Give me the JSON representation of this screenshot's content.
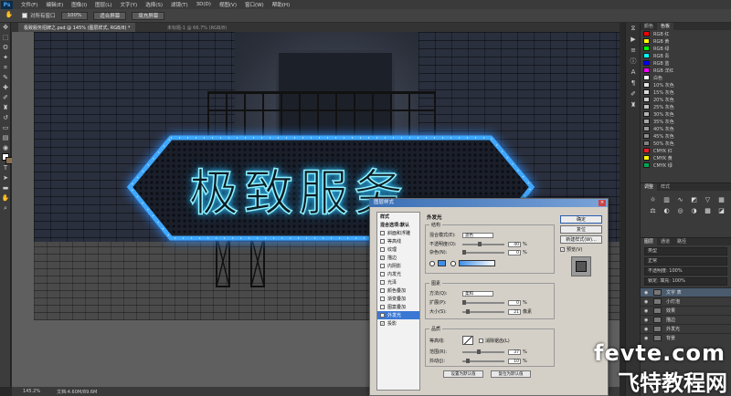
{
  "app": {
    "logo": "Ps"
  },
  "menu": [
    "文件(F)",
    "编辑(E)",
    "图像(I)",
    "图层(L)",
    "文字(Y)",
    "选择(S)",
    "滤镜(T)",
    "3D(D)",
    "视图(V)",
    "窗口(W)",
    "帮助(H)"
  ],
  "options_bar": {
    "check_label": "对所有窗口",
    "buttons": [
      "100%",
      "适合屏幕",
      "填充屏幕"
    ]
  },
  "tabs": {
    "active": "极致服务招牌之.psd @ 145% (图层样式, RGB/8) *",
    "inactive": "未标题-1 @ 66.7% (RGB/8)"
  },
  "canvas": {
    "sign_text": "极致服务"
  },
  "status": {
    "zoom": "145.2%",
    "doc_size": "文档:4.60M/89.6M"
  },
  "swatches": {
    "tabs": [
      "颜色",
      "色板"
    ],
    "items": [
      {
        "name": "RGB 红",
        "color": "#ff0000"
      },
      {
        "name": "RGB 黄",
        "color": "#ffff00"
      },
      {
        "name": "RGB 绿",
        "color": "#00ff00"
      },
      {
        "name": "RGB 青",
        "color": "#00ffff"
      },
      {
        "name": "RGB 蓝",
        "color": "#0000ff"
      },
      {
        "name": "RGB 洋红",
        "color": "#ff00ff"
      },
      {
        "name": "白色",
        "color": "#ffffff"
      },
      {
        "name": "10% 灰色",
        "color": "#e6e6e6"
      },
      {
        "name": "15% 灰色",
        "color": "#d9d9d9"
      },
      {
        "name": "20% 灰色",
        "color": "#cccccc"
      },
      {
        "name": "25% 灰色",
        "color": "#bfbfbf"
      },
      {
        "name": "30% 灰色",
        "color": "#b3b3b3"
      },
      {
        "name": "35% 灰色",
        "color": "#a6a6a6"
      },
      {
        "name": "40% 灰色",
        "color": "#999999"
      },
      {
        "name": "45% 灰色",
        "color": "#8c8c8c"
      },
      {
        "name": "50% 灰色",
        "color": "#808080"
      },
      {
        "name": "CMYK 红",
        "color": "#ed1c24"
      },
      {
        "name": "CMYK 黄",
        "color": "#fff200"
      },
      {
        "name": "CMYK 绿",
        "color": "#00a651"
      }
    ]
  },
  "adjustments": {
    "tabs": [
      "调整",
      "样式"
    ]
  },
  "layers": {
    "tabs": [
      "图层",
      "通道",
      "路径"
    ],
    "kind": "类型",
    "blend_mode": "正常",
    "opacity": "不透明度: 100%",
    "lock_fill": "锁定: 填充: 100%",
    "items": [
      "文字 表",
      "小灯泡",
      "效果",
      "描边",
      "外发光",
      "背景"
    ]
  },
  "dialog": {
    "title": "图层样式",
    "close": "×",
    "style_list": [
      {
        "label": "样式",
        "checked": false,
        "header": true
      },
      {
        "label": "混合选项:默认",
        "checked": false,
        "header": true
      },
      {
        "label": "斜面和浮雕",
        "checked": false
      },
      {
        "label": "等高线",
        "checked": false
      },
      {
        "label": "纹理",
        "checked": false
      },
      {
        "label": "描边",
        "checked": true
      },
      {
        "label": "内阴影",
        "checked": false
      },
      {
        "label": "内发光",
        "checked": false
      },
      {
        "label": "光泽",
        "checked": false
      },
      {
        "label": "颜色叠加",
        "checked": false
      },
      {
        "label": "渐变叠加",
        "checked": false
      },
      {
        "label": "图案叠加",
        "checked": false
      },
      {
        "label": "外发光",
        "checked": true,
        "selected": true
      },
      {
        "label": "投影",
        "checked": true
      }
    ],
    "outer_glow": {
      "heading": "外发光",
      "structure": {
        "title": "结构",
        "blend_label": "混合模式(E):",
        "blend_value": "滤色",
        "opacity_label": "不透明度(O):",
        "opacity_value": "40",
        "noise_label": "杂色(N):",
        "noise_value": "0",
        "unit": "%"
      },
      "elements": {
        "title": "图素",
        "method_label": "方法(Q):",
        "method_value": "柔和",
        "spread_label": "扩展(P):",
        "spread_value": "0",
        "size_label": "大小(S):",
        "size_value": "21",
        "unit_pct": "%",
        "unit_px": "像素"
      },
      "quality": {
        "title": "品质",
        "contour_label": "等高线:",
        "antialias_label": "消除锯齿(L)",
        "range_label": "范围(R):",
        "range_value": "37",
        "jitter_label": "抖动(J):",
        "jitter_value": "10",
        "unit": "%"
      },
      "default_buttons": [
        "设置为默认值",
        "复位为默认值"
      ]
    },
    "buttons": {
      "ok": "确定",
      "reset": "复位",
      "new_style": "新建样式(W)...",
      "preview": "预览(V)"
    }
  },
  "watermark": {
    "line1": "fevte.com",
    "line2": "飞特教程网"
  }
}
